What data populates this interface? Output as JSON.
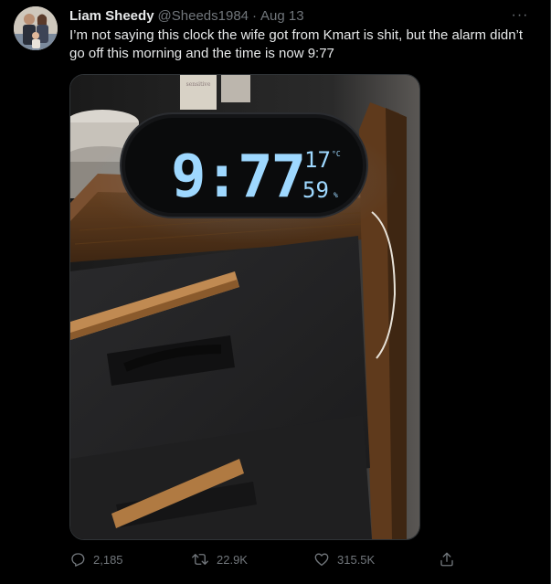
{
  "tweet": {
    "author": {
      "display_name": "Liam Sheedy",
      "handle": "@Sheeds1984",
      "separator": "·",
      "date": "Aug 13"
    },
    "more_label": "···",
    "text": "I’m not saying this clock the wife got from Kmart is shit, but the alarm didn’t go off this morning and the time is now 9:77",
    "media": {
      "clock_time": "9:77",
      "clock_temp": "17",
      "clock_temp_unit": "°C",
      "clock_humidity": "59",
      "clock_humidity_unit": "%",
      "bottle_label": "sensitive"
    },
    "actions": {
      "replies": "2,185",
      "retweets": "22.9K",
      "likes": "315.5K"
    }
  },
  "colors": {
    "background": "#000000",
    "text_primary": "#e7e9ea",
    "text_secondary": "#71767b",
    "border": "#2f3336",
    "clock_digits": "#9ed8ff"
  }
}
